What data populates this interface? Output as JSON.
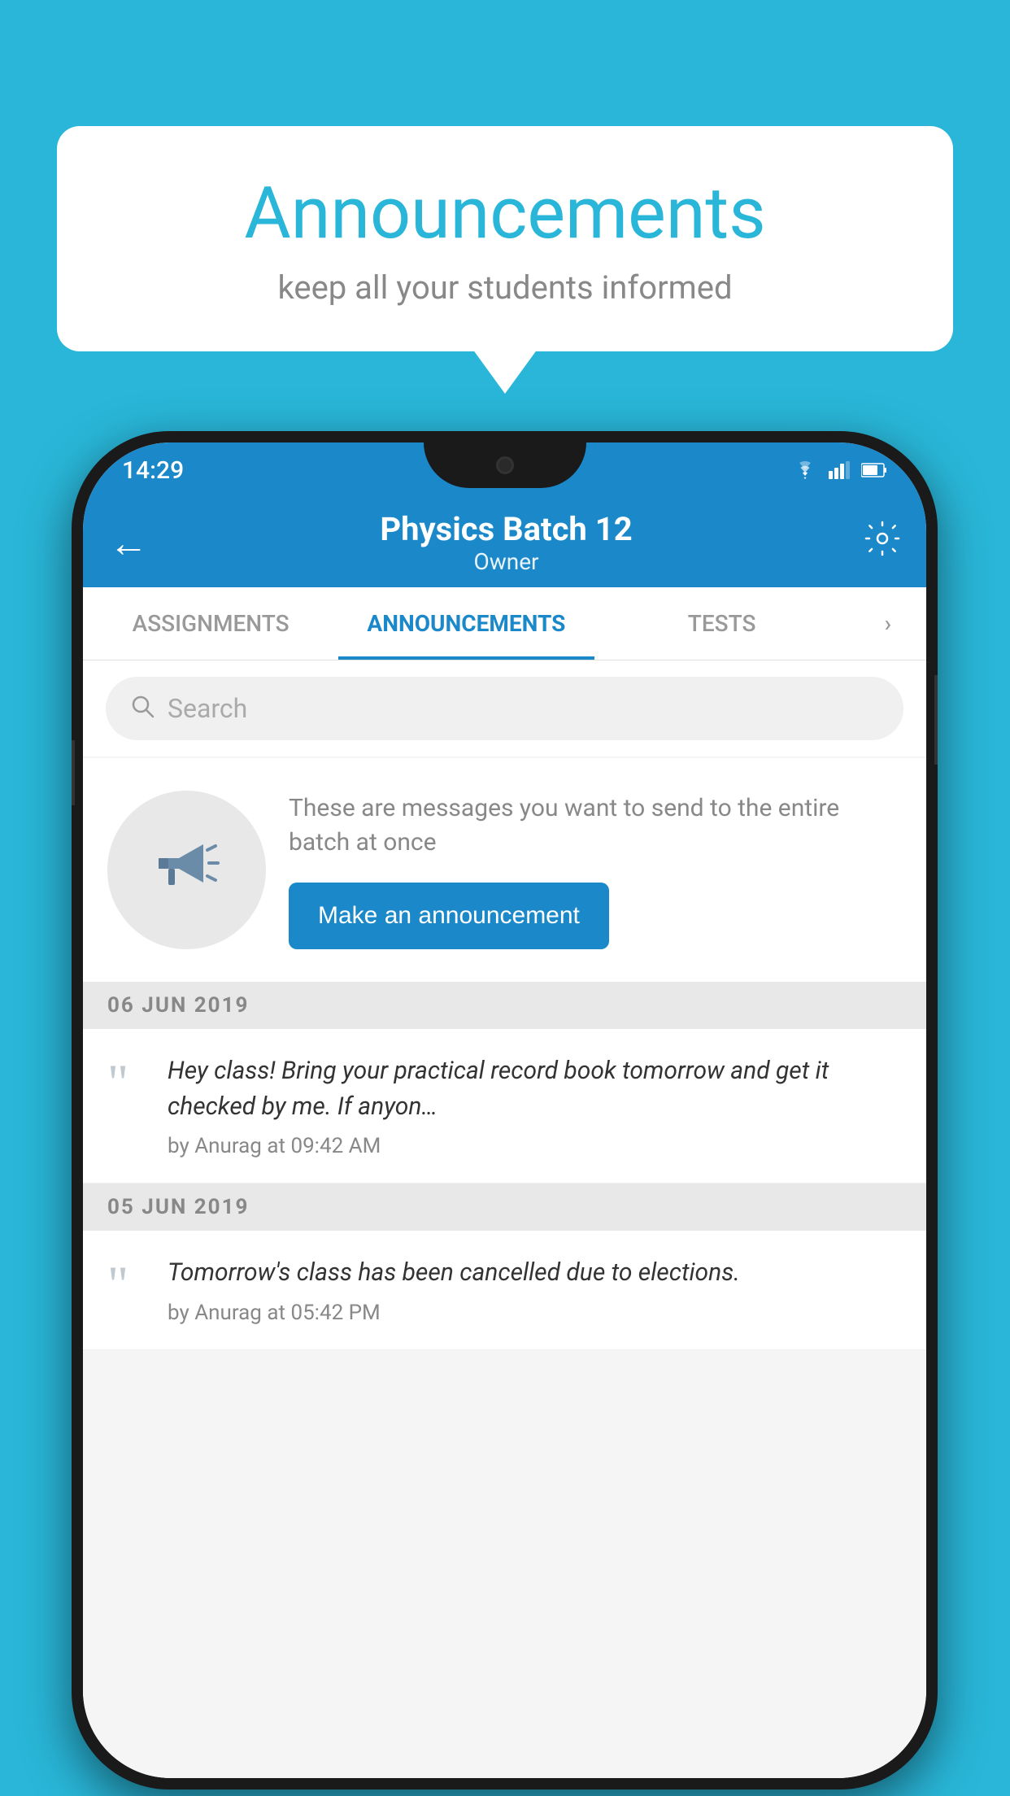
{
  "page": {
    "background_color": "#29b6d8"
  },
  "card": {
    "title": "Announcements",
    "subtitle": "keep all your students informed"
  },
  "phone": {
    "status_bar": {
      "time": "14:29"
    },
    "app_bar": {
      "title": "Physics Batch 12",
      "subtitle": "Owner",
      "back_icon": "←",
      "settings_label": "settings"
    },
    "tabs": [
      {
        "label": "ASSIGNMENTS",
        "active": false
      },
      {
        "label": "ANNOUNCEMENTS",
        "active": true
      },
      {
        "label": "TESTS",
        "active": false
      },
      {
        "label": "...",
        "active": false
      }
    ],
    "search": {
      "placeholder": "Search"
    },
    "empty_state": {
      "description": "These are messages you want to send to the entire batch at once",
      "button_label": "Make an announcement"
    },
    "announcements": [
      {
        "date": "06  JUN  2019",
        "body": "Hey class! Bring your practical record book tomorrow and get it checked by me. If anyon…",
        "meta": "by Anurag at 09:42 AM"
      },
      {
        "date": "05  JUN  2019",
        "body": "Tomorrow's class has been cancelled due to elections.",
        "meta": "by Anurag at 05:42 PM"
      }
    ]
  }
}
